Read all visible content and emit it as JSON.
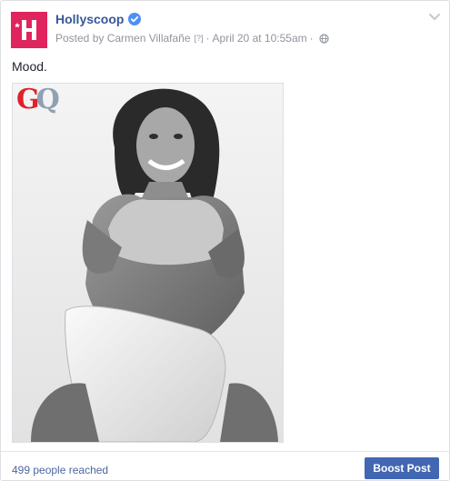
{
  "post": {
    "page_name": "Hollyscoop",
    "posted_by": "Posted by Carmen Villafañe",
    "help_marker": "[?]",
    "separator": "·",
    "timestamp": "April 20 at 10:55am",
    "message": "Mood.",
    "photo": {
      "logo_g": "G",
      "logo_q": "Q"
    },
    "avatar_letter": "H"
  },
  "footer": {
    "reach": "499 people reached",
    "boost_label": "Boost Post"
  },
  "icons": {
    "verified": "verified-badge-icon",
    "globe": "globe-icon",
    "chevron": "chevron-down-icon"
  },
  "colors": {
    "brand_pink": "#e0245e",
    "link_blue": "#365899",
    "button_blue": "#4267b2",
    "verified_blue": "#4e8ef7",
    "gq_red": "#e0212b",
    "gq_gray": "#8fa1b3"
  }
}
